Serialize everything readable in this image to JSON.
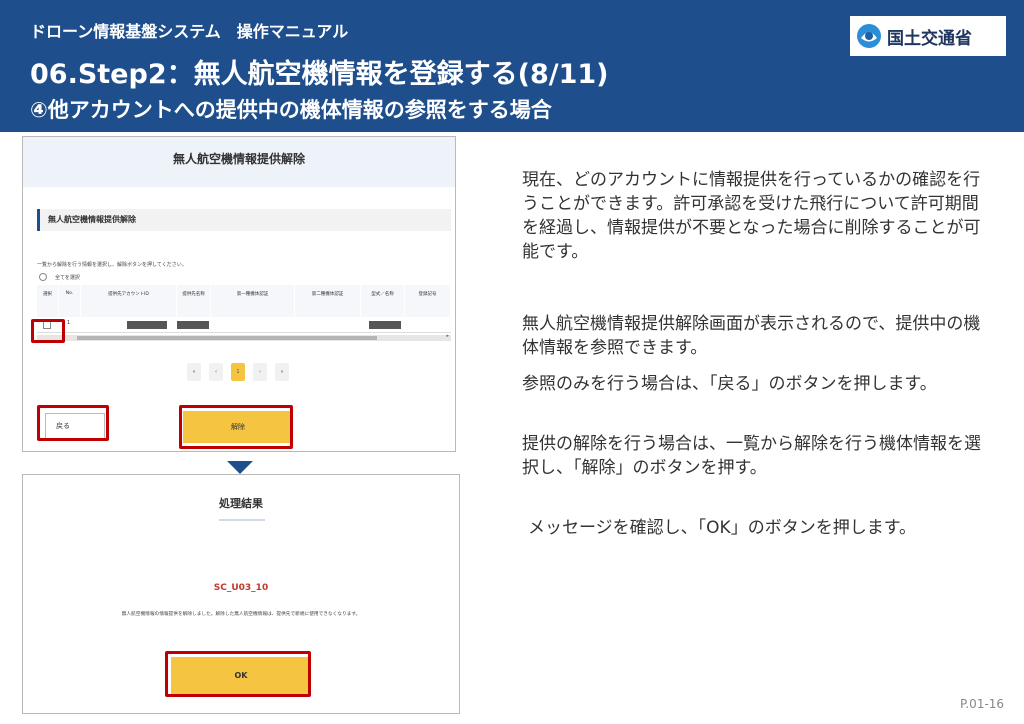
{
  "header": {
    "system_name": "ドローン情報基盤システム　操作マニュアル",
    "title": "06.Step2：無人航空機情報を登録する(8/11)",
    "subtitle": "④他アカウントへの提供中の機体情報の参照をする場合"
  },
  "logo": {
    "text": "国土交通省",
    "icon": "mlit-logo-icon"
  },
  "screen1": {
    "heading": "無人航空機情報提供解除",
    "section_title": "無人航空機情報提供解除",
    "instruction": "一覧から解除を行う情報を選択し、解除ボタンを押してください。",
    "select_all_label": "全てを選択",
    "table": {
      "columns": [
        "選択",
        "No.",
        "提供先アカウントID",
        "提供先名称",
        "第一種機体認証",
        "第二種機体認証",
        "型式／名称",
        "登録記号"
      ],
      "rows": [
        {
          "no": "1"
        }
      ]
    },
    "pager": [
      "«",
      "‹",
      "1",
      "›",
      "»"
    ],
    "back_label": "戻る",
    "release_label": "解除"
  },
  "screen2": {
    "title": "処理結果",
    "code": "SC_U03_10",
    "message": "無人航空機情報の情報提供を解除しました。解除した無人航空機情報は、提供先で新規に使用できなくなります。",
    "ok_label": "OK"
  },
  "explanation": {
    "p1": "現在、どのアカウントに情報提供を行っているかの確認を行うことができます。許可承認を受けた飛行について許可期間を経過し、情報提供が不要となった場合に削除することが可能です。",
    "p2": "無人航空機情報提供解除画面が表示されるので、提供中の機体情報を参照できます。",
    "p3": "参照のみを行う場合は、「戻る」のボタンを押します。",
    "p4": "提供の解除を行う場合は、一覧から解除を行う機体情報を選択し、「解除」のボタンを押す。",
    "p5": "メッセージを確認し、「OK」のボタンを押します。"
  },
  "page_number": "P.01-16",
  "colors": {
    "header_bg": "#1f4e8c",
    "button_yellow": "#f5c542",
    "highlight_red": "#c00000",
    "code_red": "#c0392b"
  }
}
